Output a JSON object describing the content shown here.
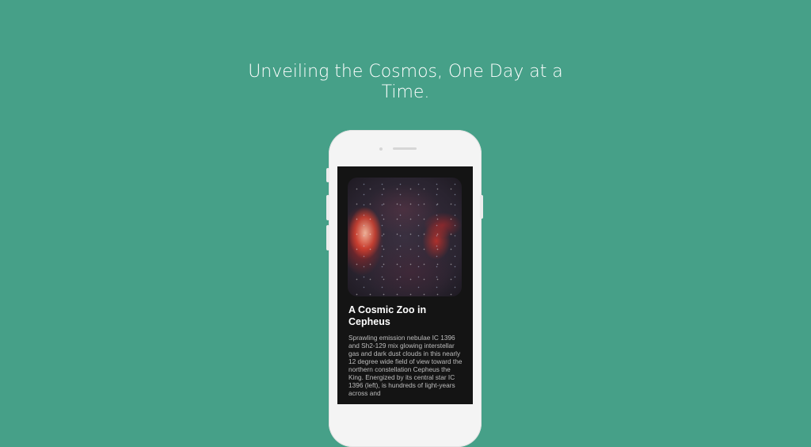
{
  "headline": "Unveiling the Cosmos, One Day at a Time.",
  "colors": {
    "background": "#46a088",
    "phone_body": "#f4f4f4",
    "screen": "#141414",
    "title_text": "#ffffff",
    "description_text": "#bdbdbd"
  },
  "apod": {
    "image_icon": "nebula-photo",
    "title": "A Cosmic Zoo in Cepheus",
    "description": "Sprawling emission nebulae IC 1396 and Sh2-129 mix glowing interstellar gas and dark dust clouds in this nearly 12 degree wide field of view toward the northern constellation Cepheus the King. Energized by its central star IC 1396 (left), is hundreds of light-years across and"
  }
}
